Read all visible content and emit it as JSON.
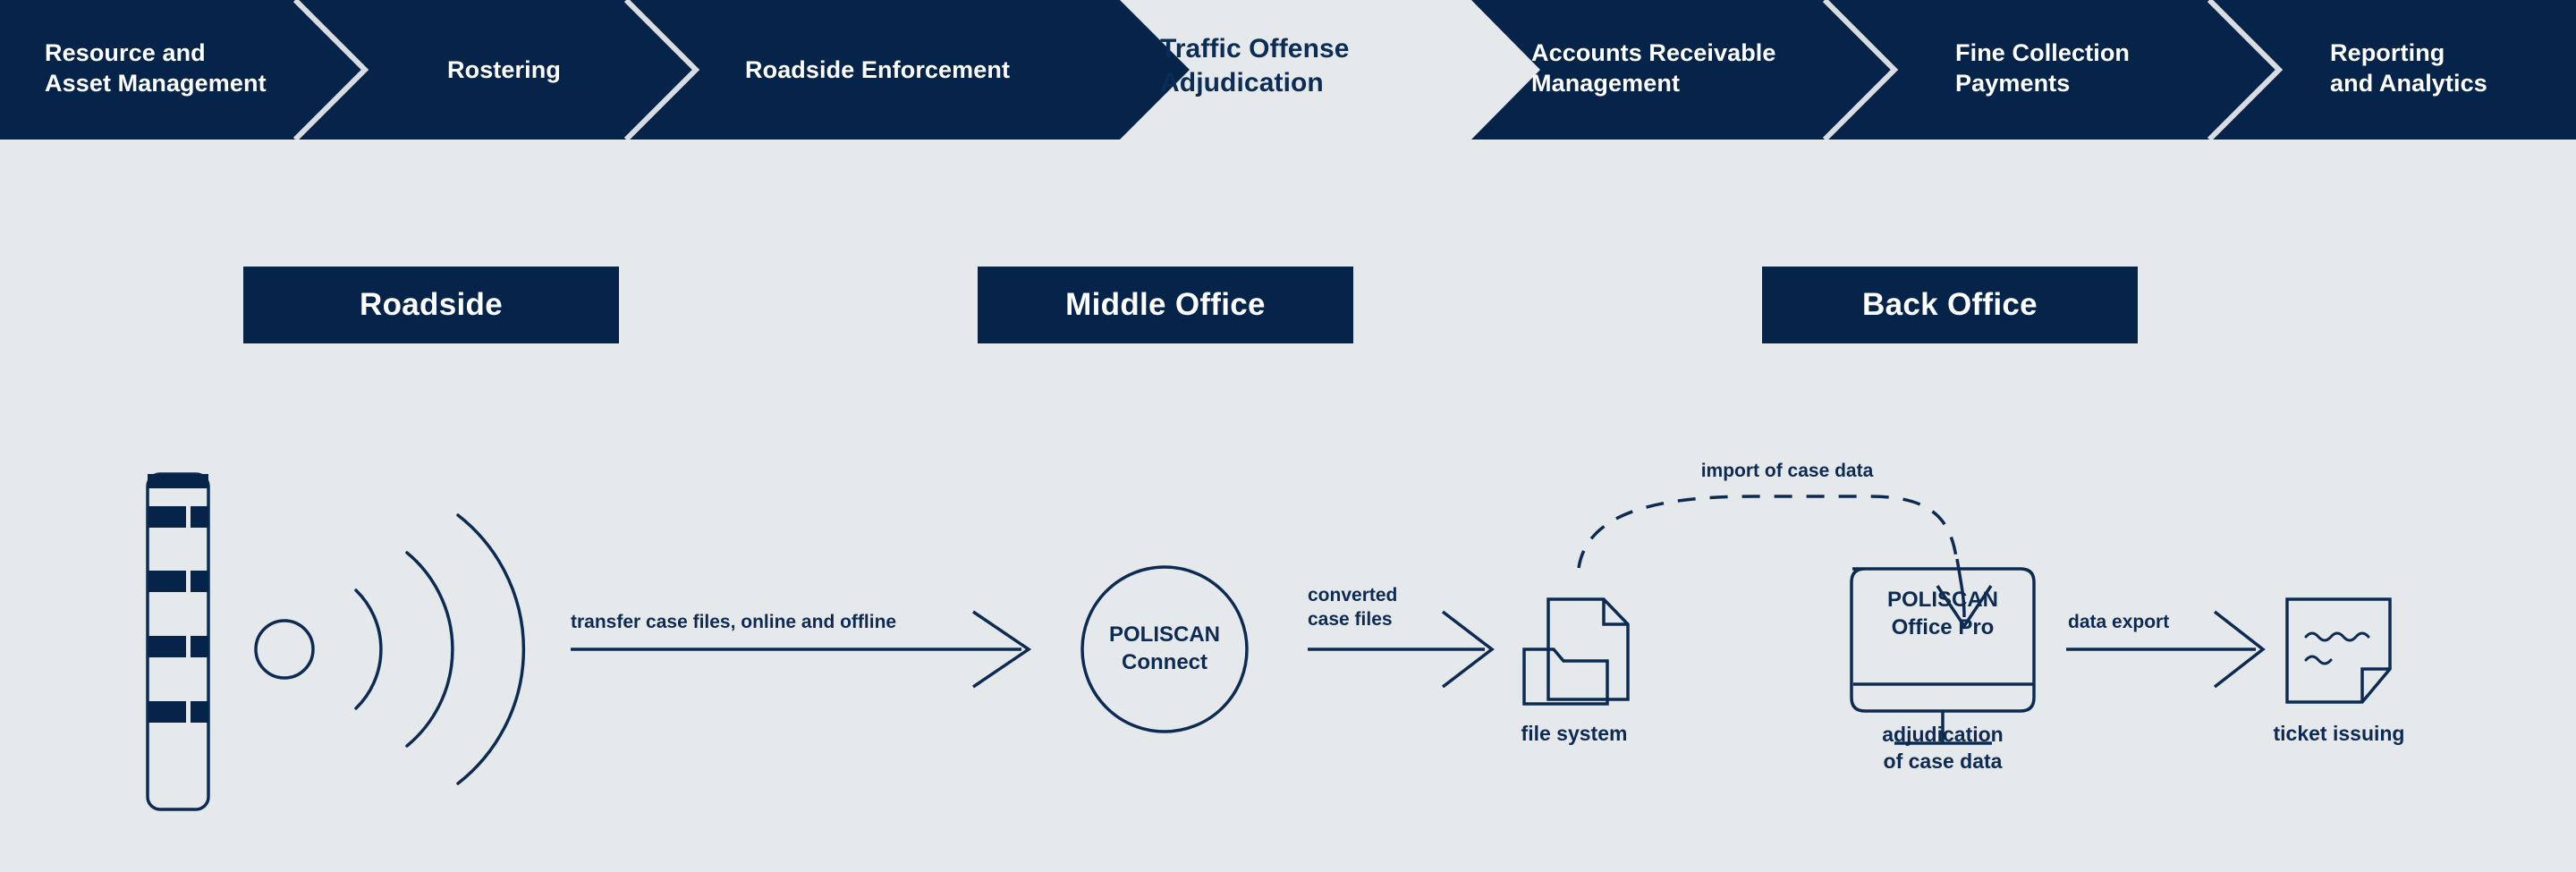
{
  "colors": {
    "navy": "#06234a",
    "line": "#0d2b52",
    "background": "#e6e9ec",
    "divider": "#d6dade",
    "text_light": "#ffffff"
  },
  "process_bar": {
    "steps": [
      {
        "label": "Resource and\nAsset Management",
        "active": false
      },
      {
        "label": "Rostering",
        "active": false
      },
      {
        "label": "Roadside Enforcement",
        "active": false
      },
      {
        "label": "Traffic Offense\nAdjudication",
        "active": true
      },
      {
        "label": "Accounts Receivable\nManagement",
        "active": false
      },
      {
        "label": "Fine Collection\nPayments",
        "active": false
      },
      {
        "label": "Reporting\nand Analytics",
        "active": false
      }
    ]
  },
  "zones": [
    {
      "label": "Roadside"
    },
    {
      "label": "Middle Office"
    },
    {
      "label": "Back Office"
    }
  ],
  "diagram": {
    "nodes": [
      {
        "name": "speed-enforcement-column",
        "label": ""
      },
      {
        "name": "poliscan-connect",
        "label": "POLISCAN\nConnect"
      },
      {
        "name": "file-system",
        "label": "file system"
      },
      {
        "name": "poliscan-office-pro",
        "label": "POLISCAN\nOffice Pro"
      },
      {
        "name": "ticket-issuing",
        "label": "ticket issuing"
      }
    ],
    "flow_labels": {
      "transfer": "transfer case files, online and offline",
      "converted": "converted\ncase files",
      "import": "import of case data",
      "export": "data export",
      "adjudication": "adjudication\nof case data"
    },
    "node_labels": {
      "poliscan_connect": "POLISCAN\nConnect",
      "file_system": "file system",
      "poliscan_office_pro": "POLISCAN\nOffice Pro",
      "ticket_issuing": "ticket issuing"
    }
  }
}
